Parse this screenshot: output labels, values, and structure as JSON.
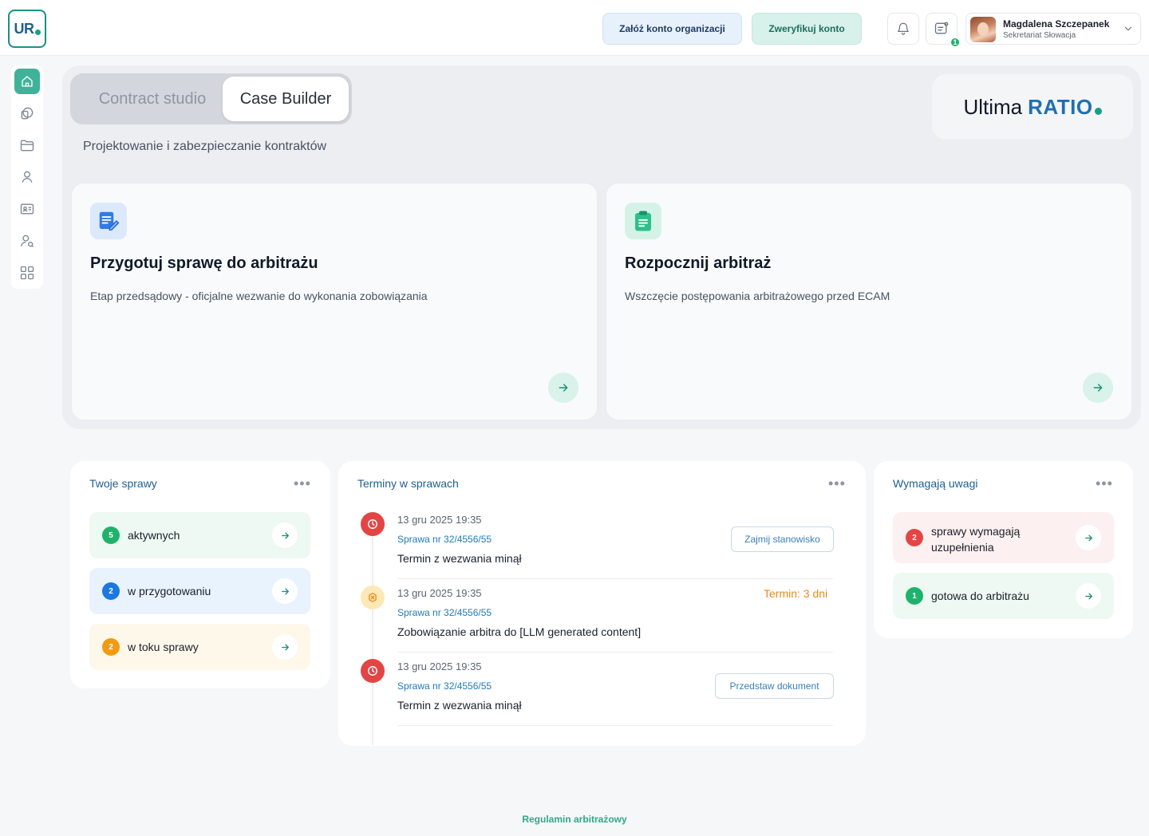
{
  "header": {
    "logo_text": "UR",
    "btn_create_org": "Załóż konto organizacji",
    "btn_verify": "Zweryfikuj konto",
    "messages_badge": "1",
    "user_name": "Magdalena Szczepanek",
    "user_role": "Sekretariat Słowacja"
  },
  "sidebar": {
    "items": [
      "home-icon",
      "cases-icon",
      "folder-icon",
      "person-icon",
      "id-card-icon",
      "user-search-icon",
      "grid-icon"
    ]
  },
  "hero": {
    "tabs": [
      "Contract studio",
      "Case Builder"
    ],
    "active_tab": "Case Builder",
    "subtitle": "Projektowanie i zabezpieczanie kontraktów",
    "brand_light": "Ultima",
    "brand_bold": "RATIO",
    "cards": [
      {
        "title": "Przygotuj sprawę do arbitrażu",
        "desc": "Etap przedsądowy - oficjalne wezwanie do wykonania zobowiązania",
        "icon": "document-edit-icon"
      },
      {
        "title": "Rozpocznij arbitraż",
        "desc": "Wszczęcie postępowania arbitrażowego przed ECAM",
        "icon": "clipboard-icon"
      }
    ]
  },
  "your_cases": {
    "title": "Twoje sprawy",
    "rows": [
      {
        "count": "5",
        "label": "aktywnych",
        "color": "#1db36b",
        "bg": "#edf9f2"
      },
      {
        "count": "2",
        "label": "w przygotowaniu",
        "color": "#1a78e0",
        "bg": "#e8f3fd"
      },
      {
        "count": "2",
        "label": "w toku sprawy",
        "color": "#f29a14",
        "bg": "#fef8ea"
      }
    ]
  },
  "deadlines": {
    "title": "Terminy w sprawach",
    "items": [
      {
        "date": "13 gru 2025  19:35",
        "case": "Sprawa nr 32/4556/55",
        "text": "Termin z wezwania minął",
        "action": "Zajmij stanowisko",
        "status": "red"
      },
      {
        "date": "13 gru 2025  19:35",
        "case": "Sprawa nr 32/4556/55",
        "text": "Zobowiązanie arbitra do [LLM generated content]",
        "deadline": "Termin: 3 dni",
        "status": "amber"
      },
      {
        "date": "13 gru 2025  19:35",
        "case": "Sprawa nr 32/4556/55",
        "text": "Termin z wezwania minął",
        "action": "Przedstaw dokument",
        "status": "red"
      }
    ]
  },
  "attention": {
    "title": "Wymagają uwagi",
    "rows": [
      {
        "count": "2",
        "label_line1": "sprawy wymagają",
        "label_line2": "uzupełnienia",
        "color": "#e34545",
        "bg": "#fdf0f0"
      },
      {
        "count": "1",
        "label": "gotowa do arbitrażu",
        "color": "#1db36b",
        "bg": "#edf9f2"
      }
    ]
  },
  "footer": {
    "link": "Regulamin arbitrażowy"
  }
}
